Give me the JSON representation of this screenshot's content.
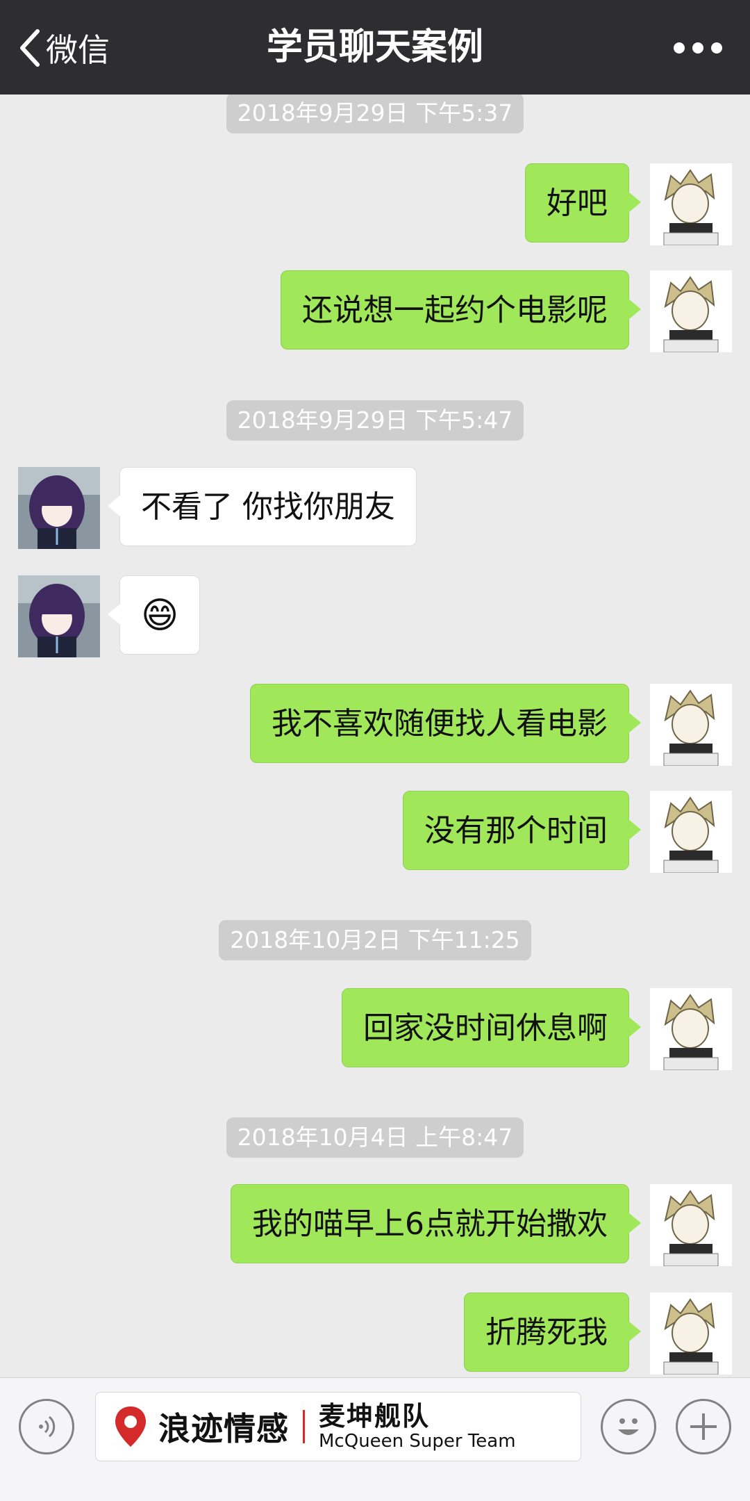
{
  "nav": {
    "back_label": "微信",
    "title": "学员聊天案例"
  },
  "messages": [
    {
      "type": "timestamp",
      "text": "2018年9月29日 下午5:37"
    },
    {
      "type": "msg",
      "side": "right",
      "text": "好吧"
    },
    {
      "type": "msg",
      "side": "right",
      "text": "还说想一起约个电影呢"
    },
    {
      "type": "timestamp",
      "text": "2018年9月29日 下午5:47"
    },
    {
      "type": "msg",
      "side": "left",
      "text": "不看了 你找你朋友"
    },
    {
      "type": "msg",
      "side": "left",
      "text": "😄"
    },
    {
      "type": "msg",
      "side": "right",
      "text": "我不喜欢随便找人看电影"
    },
    {
      "type": "msg",
      "side": "right",
      "text": "没有那个时间"
    },
    {
      "type": "timestamp",
      "text": "2018年10月2日 下午11:25"
    },
    {
      "type": "msg",
      "side": "right",
      "text": "回家没时间休息啊"
    },
    {
      "type": "timestamp",
      "text": "2018年10月4日 上午8:47"
    },
    {
      "type": "msg",
      "side": "right",
      "text": "我的喵早上6点就开始撒欢"
    },
    {
      "type": "msg",
      "side": "right",
      "text": "折腾死我"
    }
  ],
  "banner": {
    "brand_cn": "浪迹情感",
    "team_cn": "麦坤舰队",
    "team_en": "McQueen Super Team"
  },
  "icons": {
    "back": "chevron-left-icon",
    "more": "more-dots-icon",
    "voice": "voice-icon",
    "emoji": "emoji-icon",
    "add": "plus-icon",
    "logo": "location-pin-logo"
  },
  "colors": {
    "nav_bg": "#2e2e30",
    "chat_bg": "#ebebeb",
    "sent_bubble": "#a0e75a",
    "received_bubble": "#ffffff",
    "brand_red": "#d42a2a"
  }
}
